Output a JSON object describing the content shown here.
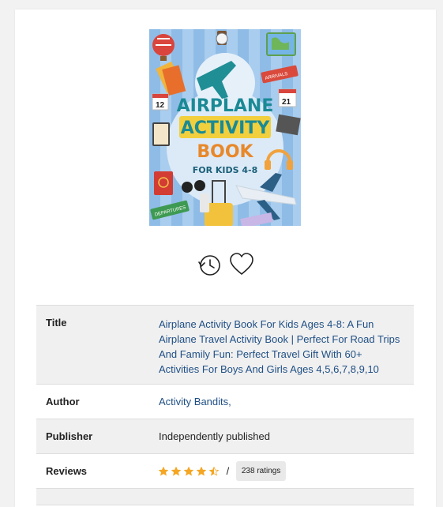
{
  "book": {
    "cover": {
      "title_line1": "AIRPLANE",
      "title_line2": "ACTIVITY",
      "title_line3": "BOOK",
      "subtitle": "FOR KIDS 4-8",
      "sign_arrivals": "ARRIVALS",
      "sign_departures": "DEPARTURES",
      "calendar_left": "12",
      "calendar_right": "21"
    },
    "actions": {
      "history_icon": "clock-history-icon",
      "favorite_icon": "heart-icon"
    },
    "details": {
      "title_label": "Title",
      "title_value": "Airplane Activity Book For Kids Ages 4-8: A Fun Airplane Travel Activity Book | Perfect For Road Trips And Family Fun: Perfect Travel Gift With 60+ Activities For Boys And Girls Ages 4,5,6,7,8,9,10",
      "author_label": "Author",
      "author_value": "Activity Bandits,",
      "publisher_label": "Publisher",
      "publisher_value": "Independently published",
      "reviews_label": "Reviews",
      "rating": 4.5,
      "rating_separator": "/",
      "ratings_count": "238 ratings"
    }
  },
  "colors": {
    "link": "#1f4f85",
    "star": "#f5a623",
    "row_shade": "#f0f0f0"
  }
}
